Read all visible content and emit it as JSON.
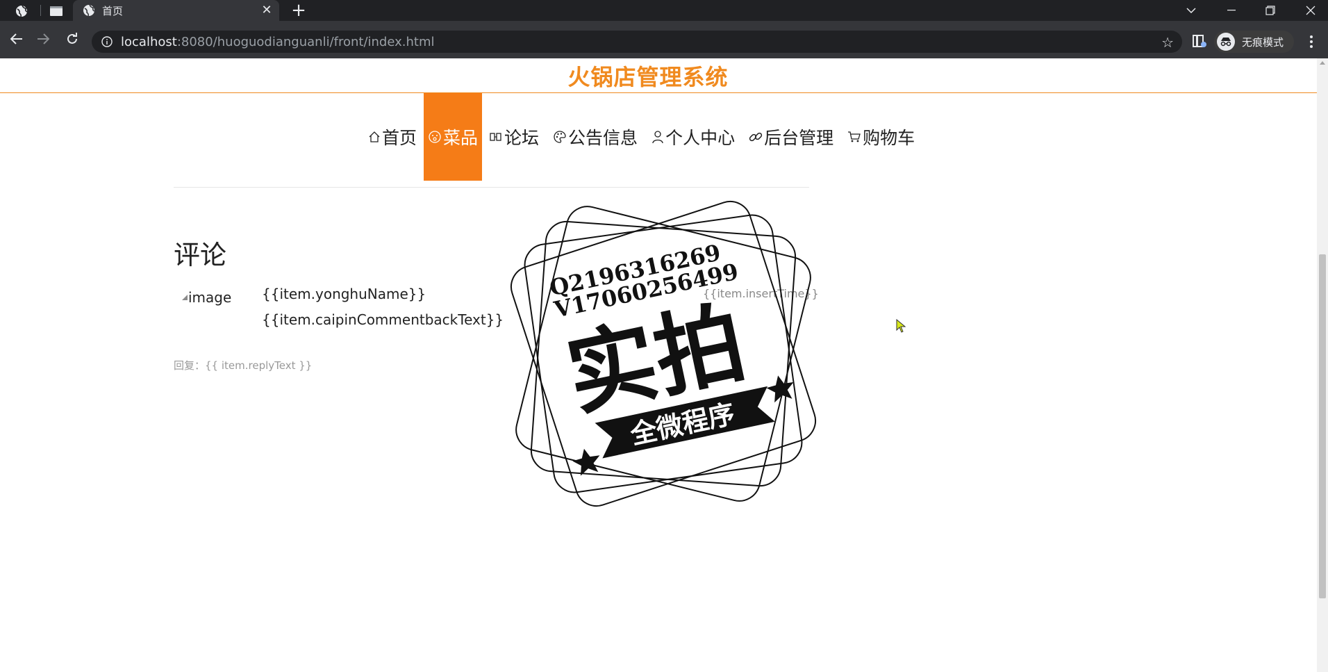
{
  "browser": {
    "tab_title": "首页",
    "url_host": "localhost",
    "url_path": ":8080/huoguodianguanli/front/index.html",
    "incognito_label": "无痕模式"
  },
  "site": {
    "title": "火锅店管理系统",
    "accent_color": "#f08a1f",
    "active_color": "#f57c17"
  },
  "nav": {
    "items": [
      {
        "label": "首页",
        "icon": "home-icon"
      },
      {
        "label": "菜品",
        "icon": "smile-icon",
        "active": true
      },
      {
        "label": "论坛",
        "icon": "forum-icon"
      },
      {
        "label": "公告信息",
        "icon": "palette-icon"
      },
      {
        "label": "个人中心",
        "icon": "user-icon"
      },
      {
        "label": "后台管理",
        "icon": "link-icon"
      },
      {
        "label": "购物车",
        "icon": "cart-icon"
      }
    ]
  },
  "comments": {
    "heading": "评论",
    "image_alt": "image",
    "user_name": "{{item.yonghuName}}",
    "comment_text": "{{item.caipinCommentbackText}}",
    "insert_time": "{{item.insertTime}}",
    "reply": "回复：{{ item.replyText }}"
  },
  "watermark": {
    "line1": "Q2196316269",
    "line2": "V17060256499",
    "big_text": "实拍",
    "ribbon_text": "全微程序"
  }
}
